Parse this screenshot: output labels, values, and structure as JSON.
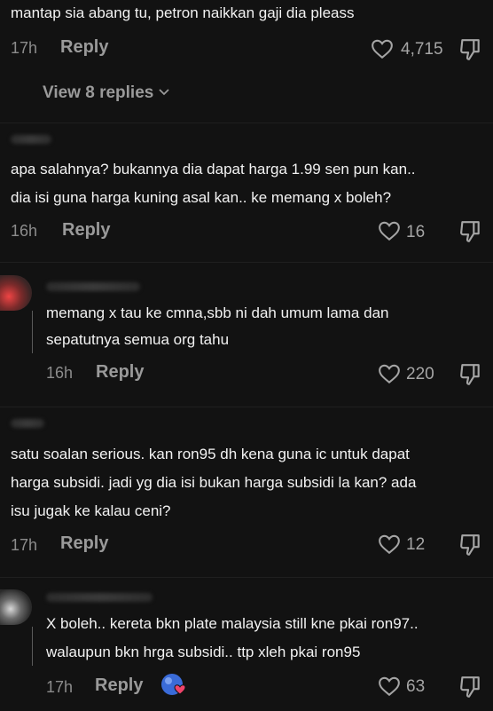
{
  "comments": [
    {
      "text": "mantap sia abang tu, petron naikkan gaji dia pleass",
      "time": "17h",
      "reply_label": "Reply",
      "likes": "4,715",
      "view_replies": "View 8 replies"
    },
    {
      "text_lines": [
        "apa salahnya? bukannya dia dapat harga 1.99 sen pun kan..",
        "dia isi guna harga kuning asal kan.. ke memang x boleh?"
      ],
      "time": "16h",
      "reply_label": "Reply",
      "likes": "16"
    },
    {
      "text_lines": [
        "memang x tau ke cmna,sbb ni dah umum lama dan",
        "sepatutnya semua org tahu"
      ],
      "time": "16h",
      "reply_label": "Reply",
      "likes": "220"
    },
    {
      "text_lines": [
        "satu soalan serious. kan ron95 dh kena guna ic untuk dapat",
        "harga subsidi. jadi yg dia isi bukan harga subsidi la kan? ada",
        "isu jugak ke kalau ceni?"
      ],
      "time": "17h",
      "reply_label": "Reply",
      "likes": "12"
    },
    {
      "text_lines": [
        "X boleh.. kereta bkn plate malaysia still kne pkai ron97..",
        "walaupun bkn hrga subsidi.. ttp xleh pkai ron95"
      ],
      "time": "17h",
      "reply_label": "Reply",
      "likes": "63"
    }
  ],
  "icons": {
    "like": "heart-outline-icon",
    "dislike": "thumbs-down-icon",
    "chevron": "chevron-down-icon"
  },
  "colors": {
    "background": "#121212",
    "text": "#f2f2f2",
    "muted": "#8c8c8c"
  }
}
